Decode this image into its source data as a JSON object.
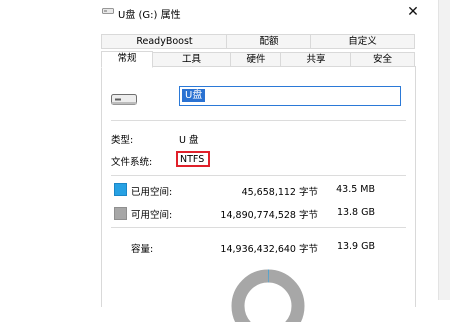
{
  "window": {
    "title": "U盘 (G:) 属性",
    "close_glyph": "✕"
  },
  "tabs_row1": [
    "ReadyBoost",
    "配额",
    "自定义"
  ],
  "tabs_row2": [
    "常规",
    "工具",
    "硬件",
    "共享",
    "安全"
  ],
  "active_tab": "常规",
  "general": {
    "volume_name": "U盘",
    "type_label": "类型:",
    "type_value": "U 盘",
    "fs_label": "文件系统:",
    "fs_value": "NTFS",
    "used_label": "已用空间:",
    "used_bytes": "45,658,112 字节",
    "used_size": "43.5 MB",
    "free_label": "可用空间:",
    "free_bytes": "14,890,774,528 字节",
    "free_size": "13.8 GB",
    "capacity_label": "容量:",
    "capacity_bytes": "14,936,432,640 字节",
    "capacity_size": "13.9 GB",
    "used_fraction": 0.003
  },
  "colors": {
    "used": "#27a1e3",
    "free": "#a7a7a7",
    "highlight_box": "#e0202a",
    "selection": "#2a72d2"
  },
  "icons": {
    "drive": "usb-drive-icon",
    "close": "close-icon"
  }
}
